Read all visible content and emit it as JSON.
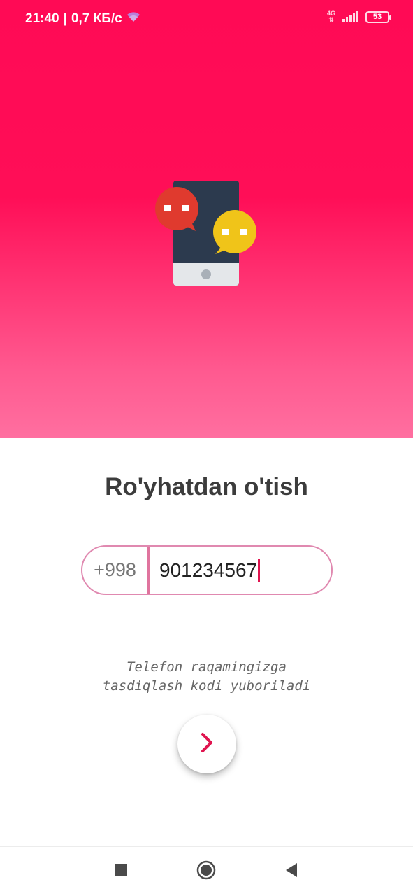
{
  "status_bar": {
    "time": "21:40",
    "separator": "|",
    "speed": "0,7 КБ/с",
    "network_type": "4G",
    "battery": "53"
  },
  "screen": {
    "title": "Ro'yhatdan o'tish",
    "phone": {
      "prefix": "+998",
      "value": "901234567"
    },
    "hint_line1": "Telefon raqamingizga",
    "hint_line2": "tasdiqlash kodi yuboriladi"
  },
  "colors": {
    "accent": "#ff0a55",
    "bubble_red": "#e03a2e",
    "bubble_yellow": "#f0c419",
    "phone_body": "#2c3a4e"
  },
  "icons": {
    "wifi": "wifi-icon",
    "signal": "signal-icon",
    "battery": "battery-icon",
    "next": "chevron-right-icon",
    "recents": "square-icon",
    "home": "circle-icon",
    "back": "triangle-back-icon"
  }
}
